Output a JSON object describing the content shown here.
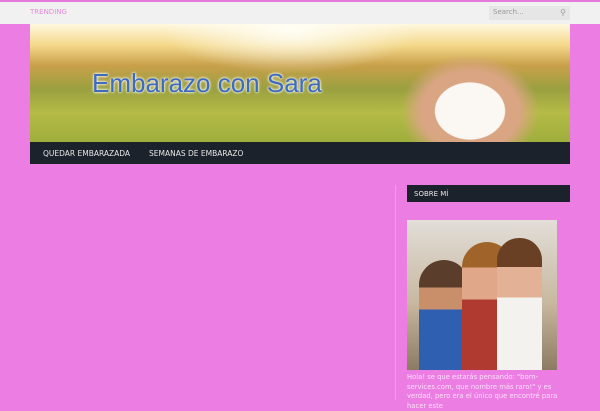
{
  "topbar": {
    "trending_label": "TRENDING",
    "search_placeholder": "Search...",
    "search_icon": "magnifier"
  },
  "header": {
    "site_title": "Embarazo con Sara"
  },
  "nav": {
    "items": [
      {
        "label": "QUEDAR EMBARAZADA"
      },
      {
        "label": "SEMANAS DE EMBARAZO"
      }
    ]
  },
  "sidebar": {
    "widget_title": "SOBRE MÍ",
    "about_text": "Hola! se que estarás pensando: \"born-services.com, que nombre más raro!\" y es verdad, pero era el único que encontré para hacer este"
  },
  "colors": {
    "background": "#eb7de3",
    "nav": "#1c222b",
    "title": "#3f6bbf"
  }
}
